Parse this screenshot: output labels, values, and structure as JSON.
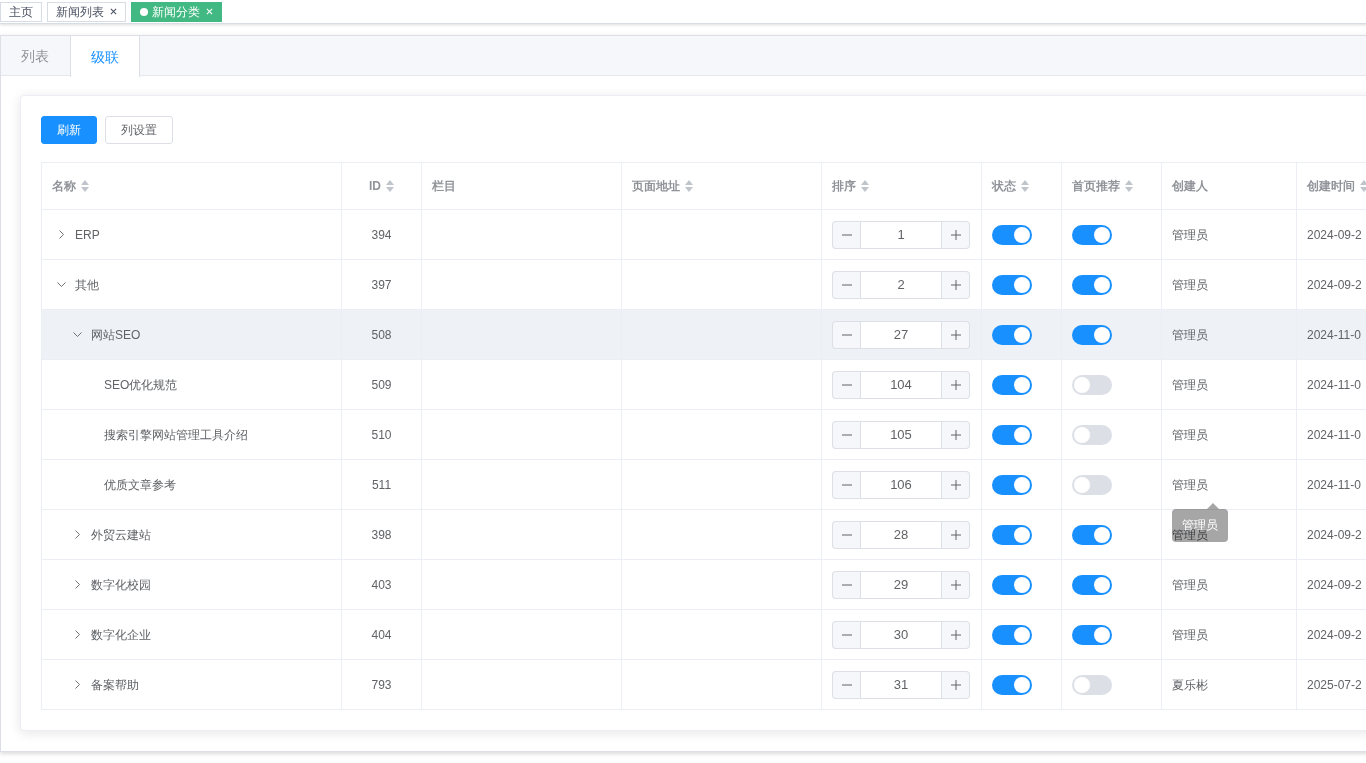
{
  "page_tabs": [
    {
      "label": "主页",
      "selected": false,
      "closable": false
    },
    {
      "label": "新闻列表",
      "selected": false,
      "closable": true
    },
    {
      "label": "新闻分类",
      "selected": true,
      "closable": true
    }
  ],
  "view_tabs": [
    {
      "label": "列表",
      "selected": false
    },
    {
      "label": "级联",
      "selected": true
    }
  ],
  "toolbar": [
    {
      "label": "刷新",
      "kind": "primary"
    },
    {
      "label": "列设置",
      "kind": "default"
    }
  ],
  "table": {
    "columns": [
      {
        "label": "名称",
        "sortable": true
      },
      {
        "label": "ID",
        "sortable": true
      },
      {
        "label": "栏目",
        "sortable": false
      },
      {
        "label": "页面地址",
        "sortable": true
      },
      {
        "label": "排序",
        "sortable": true
      },
      {
        "label": "状态",
        "sortable": true
      },
      {
        "label": "首页推荐",
        "sortable": true
      },
      {
        "label": "创建人",
        "sortable": false
      },
      {
        "label": "创建时间",
        "sortable": true
      }
    ],
    "rows": [
      {
        "kind": "branch",
        "expanded": false,
        "name": "ERP",
        "id": "394",
        "sort": "1",
        "status_on": true,
        "recommended": true,
        "creator": "管理员",
        "created": "2024-09-2",
        "highlighted": false
      },
      {
        "kind": "branch",
        "expanded": true,
        "name": "其他",
        "id": "397",
        "sort": "2",
        "status_on": true,
        "recommended": true,
        "creator": "管理员",
        "created": "2024-09-2",
        "highlighted": false,
        "children": [
          {
            "kind": "branch",
            "expanded": true,
            "name": "网站SEO",
            "id": "508",
            "sort": "27",
            "status_on": true,
            "recommended": true,
            "creator": "管理员",
            "created": "2024-11-0",
            "highlighted": true,
            "children": [
              {
                "kind": "leaf",
                "name": "SEO优化规范",
                "id": "509",
                "sort": "104",
                "status_on": true,
                "recommended": false,
                "creator": "管理员",
                "created": "2024-11-0",
                "highlighted": false
              },
              {
                "kind": "leaf",
                "name": "搜索引擎网站管理工具介绍",
                "id": "510",
                "sort": "105",
                "status_on": true,
                "recommended": false,
                "creator": "管理员",
                "created": "2024-11-0",
                "highlighted": false
              },
              {
                "kind": "leaf",
                "name": "优质文章参考",
                "id": "511",
                "sort": "106",
                "status_on": true,
                "recommended": false,
                "creator": "管理员",
                "created": "2024-11-0",
                "highlighted": false,
                "tooltip": "管理员"
              }
            ]
          },
          {
            "kind": "branch",
            "expanded": false,
            "name": "外贸云建站",
            "id": "398",
            "sort": "28",
            "status_on": true,
            "recommended": true,
            "creator": "管理员",
            "created": "2024-09-2",
            "highlighted": false
          },
          {
            "kind": "branch",
            "expanded": false,
            "name": "数字化校园",
            "id": "403",
            "sort": "29",
            "status_on": true,
            "recommended": true,
            "creator": "管理员",
            "created": "2024-09-2",
            "highlighted": false
          },
          {
            "kind": "branch",
            "expanded": false,
            "name": "数字化企业",
            "id": "404",
            "sort": "30",
            "status_on": true,
            "recommended": true,
            "creator": "管理员",
            "created": "2024-09-2",
            "highlighted": false
          },
          {
            "kind": "branch",
            "expanded": false,
            "name": "备案帮助",
            "id": "793",
            "sort": "31",
            "status_on": true,
            "recommended": false,
            "creator": "夏乐彬",
            "created": "2025-07-2",
            "highlighted": false
          }
        ]
      }
    ]
  }
}
